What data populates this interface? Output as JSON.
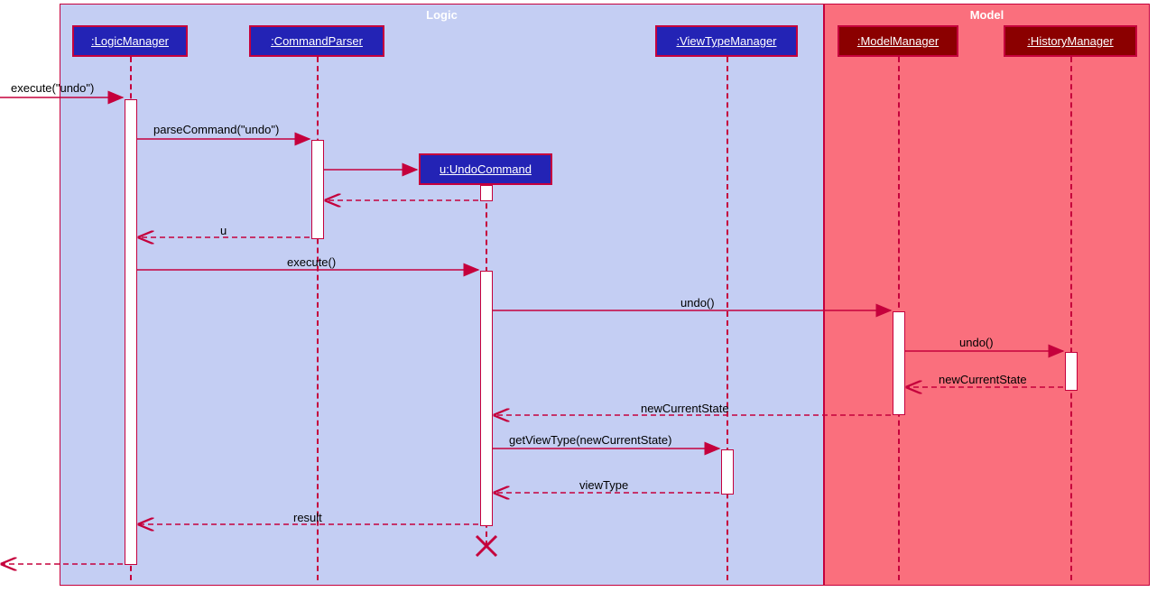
{
  "frames": {
    "logic": "Logic",
    "model": "Model"
  },
  "participants": {
    "logicManager": ":LogicManager",
    "commandParser": ":CommandParser",
    "undoCommand": "u:UndoCommand",
    "viewTypeManager": ":ViewTypeManager",
    "modelManager": ":ModelManager",
    "historyManager": ":HistoryManager"
  },
  "messages": {
    "execute_undo": "execute(\"undo\")",
    "parseCommand": "parseCommand(\"undo\")",
    "u_return": "u",
    "execute2": "execute()",
    "undo1": "undo()",
    "undo2": "undo()",
    "newCurrentState1": "newCurrentState",
    "newCurrentState2": "newCurrentState",
    "getViewType": "getViewType(newCurrentState)",
    "viewType": "viewType",
    "result": "result"
  },
  "colors": {
    "frameBorder": "#c5003c",
    "arrow": "#c5003c",
    "logicFill": "#c4cef3",
    "modelFill": "#fa6f7d",
    "logicHead": "#2323b5",
    "modelHead": "#8b0000"
  }
}
